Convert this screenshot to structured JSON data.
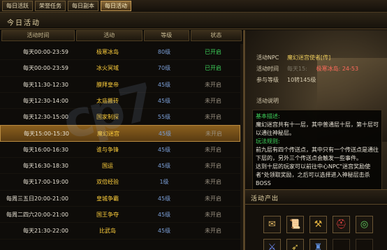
{
  "tabs": [
    {
      "label": "每日活跃",
      "active": false
    },
    {
      "label": "荣誉任务",
      "active": false
    },
    {
      "label": "每日副本",
      "active": false
    },
    {
      "label": "每日活动",
      "active": true
    }
  ],
  "title": "今日活动",
  "columns": [
    "活动时间",
    "活动",
    "等级",
    "状态"
  ],
  "rows": [
    {
      "time": "每天00:00-23:59",
      "name": "极寒冰岛",
      "level": "80级",
      "status": "已开启",
      "on": true
    },
    {
      "time": "每天00:00-23:59",
      "name": "冰火冥域",
      "level": "70级",
      "status": "已开启",
      "on": true
    },
    {
      "time": "每天11:30-12:30",
      "name": "膜拜皇帝",
      "level": "45级",
      "status": "未开启",
      "on": false
    },
    {
      "time": "每天12:30-14:00",
      "name": "太庙搬砖",
      "level": "45级",
      "status": "未开启",
      "on": false
    },
    {
      "time": "每天12:30-15:00",
      "name": "国家制探",
      "level": "55级",
      "status": "未开启",
      "on": false
    },
    {
      "time": "每天15:00-15:30",
      "name": "魔幻迷宫",
      "level": "45级",
      "status": "未开启",
      "on": false,
      "selected": true
    },
    {
      "time": "每天16:00-16:30",
      "name": "谁与争锋",
      "level": "45级",
      "status": "未开启",
      "on": false
    },
    {
      "time": "每天16:30-18:30",
      "name": "国运",
      "level": "45级",
      "status": "未开启",
      "on": false
    },
    {
      "time": "每天17:00-19:00",
      "name": "双倍经验",
      "level": "1级",
      "status": "未开启",
      "on": false
    },
    {
      "time": "每周三五日20:00-21:00",
      "name": "皇城争霸",
      "level": "45级",
      "status": "未开启",
      "on": false
    },
    {
      "time": "每周二四六20:00-21:00",
      "name": "国王争夺",
      "level": "45级",
      "status": "未开启",
      "on": false
    },
    {
      "time": "每天21:30-22:00",
      "name": "比武岛",
      "level": "45级",
      "status": "未开启",
      "on": false
    }
  ],
  "detail": {
    "npc_label": "活动NPC",
    "npc_value": "魔幻迷宫使者[传]",
    "time_label": "活动时间",
    "time_value": "每天15:",
    "time_location": "极寒冰岛: 24-53",
    "level_label": "参与等级",
    "level_value": "10转145级",
    "desc_label": "活动说明",
    "desc_title": "基本描述:",
    "desc_text": "魔幻迷宫共有十一层，其中普通层十层，第十层可以通往神秘层。",
    "rule_title": "玩法规则:",
    "rule_text1": "前九层有四个传送点，其中只有一个传送点是通往下层的，另外三个传送点会触发一些事件。",
    "rule_text2": "达到十层的玩家可以前往中心NPC\"迷宫奖励使者\"处领取奖励，之后可以选择进入神秘层击杀BOSS"
  },
  "drops_title": "活动产出",
  "drops": [
    {
      "icon": "treasure-map-icon",
      "glyph": "✉",
      "color": "#d8b060"
    },
    {
      "icon": "scroll-icon",
      "glyph": "📜",
      "color": "#e0c080"
    },
    {
      "icon": "hammer-icon",
      "glyph": "⚒",
      "color": "#e0b040"
    },
    {
      "icon": "red-helmet-icon",
      "glyph": "⛑",
      "color": "#e04040"
    },
    {
      "icon": "green-ring-icon",
      "glyph": "◎",
      "color": "#60d060"
    },
    {
      "icon": "blue-sword-icon",
      "glyph": "⚔",
      "color": "#7090ff"
    },
    {
      "icon": "gold-bow-icon",
      "glyph": "➶",
      "color": "#e0c050"
    },
    {
      "icon": "blue-armor-icon",
      "glyph": "♜",
      "color": "#6090e0"
    },
    {
      "icon": "empty-slot",
      "glyph": "",
      "color": ""
    },
    {
      "icon": "empty-slot",
      "glyph": "",
      "color": ""
    }
  ],
  "watermark": "cp7"
}
